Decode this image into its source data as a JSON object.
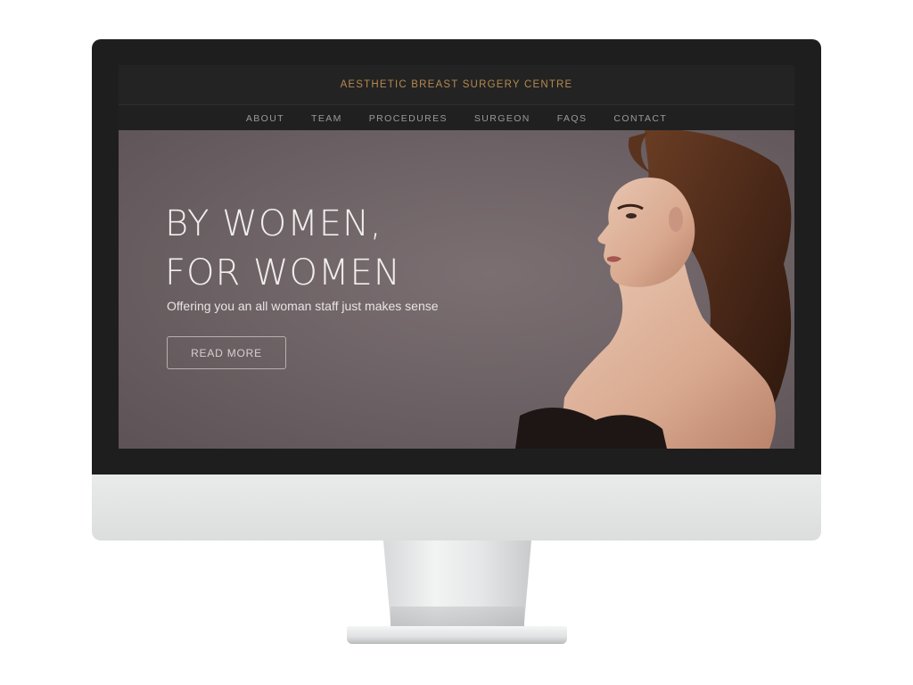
{
  "site": {
    "title": "AESTHETIC BREAST SURGERY CENTRE"
  },
  "nav": {
    "items": [
      {
        "label": "ABOUT"
      },
      {
        "label": "TEAM"
      },
      {
        "label": "PROCEDURES"
      },
      {
        "label": "SURGEON"
      },
      {
        "label": "FAQS"
      },
      {
        "label": "CONTACT"
      }
    ]
  },
  "hero": {
    "title_line1": "BY WOMEN,",
    "title_line2": "FOR WOMEN",
    "subtitle": "Offering you an all woman staff just makes sense",
    "button_label": "READ MORE",
    "image": "woman-profile-portrait"
  },
  "colors": {
    "accent_gold": "#b4894f",
    "header_bg": "#232323",
    "hero_bg": "#6e6366",
    "bezel": "#1e1e1e",
    "chin": "#e4e5e5"
  }
}
